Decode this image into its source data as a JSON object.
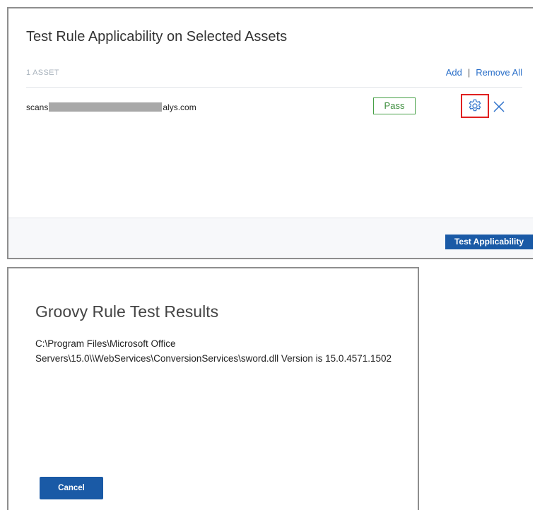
{
  "test_panel": {
    "title": "Test Rule Applicability on Selected Assets",
    "asset_count": "1 ASSET",
    "add_label": "Add",
    "separator": "|",
    "remove_all_label": "Remove All",
    "assets": [
      {
        "host_prefix": "scans",
        "host_suffix": "alys.com",
        "status": "Pass"
      }
    ],
    "test_button_label": "Test Applicability"
  },
  "result_dialog": {
    "title": "Groovy Rule Test Results",
    "message": "C:\\Program Files\\Microsoft Office Servers\\15.0\\\\WebServices\\ConversionServices\\sword.dll Version is 15.0.4571.1502",
    "cancel_label": "Cancel"
  },
  "colors": {
    "accent": "#1a5aa6",
    "link": "#2a6fc9",
    "pass": "#46a046",
    "highlight_box": "#e02020"
  },
  "icons": {
    "settings": "gear-icon",
    "remove": "close-icon"
  }
}
